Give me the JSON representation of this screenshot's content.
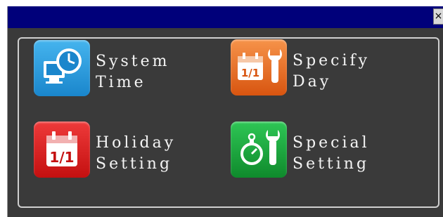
{
  "window": {
    "close_symbol": "×"
  },
  "items": [
    {
      "line1": "System",
      "line2": "Time",
      "icon": "clock-monitor-icon",
      "color": "#1e95d6"
    },
    {
      "line1": "Specify",
      "line2": "Day",
      "icon": "calendar-wrench-icon",
      "color": "#e8661c"
    },
    {
      "line1": "Holiday",
      "line2": "Setting",
      "icon": "calendar-icon",
      "color": "#d81a1a"
    },
    {
      "line1": "Special",
      "line2": "Setting",
      "icon": "stopwatch-wrench-icon",
      "color": "#16a83a"
    }
  ],
  "calendar_text": "1/1"
}
